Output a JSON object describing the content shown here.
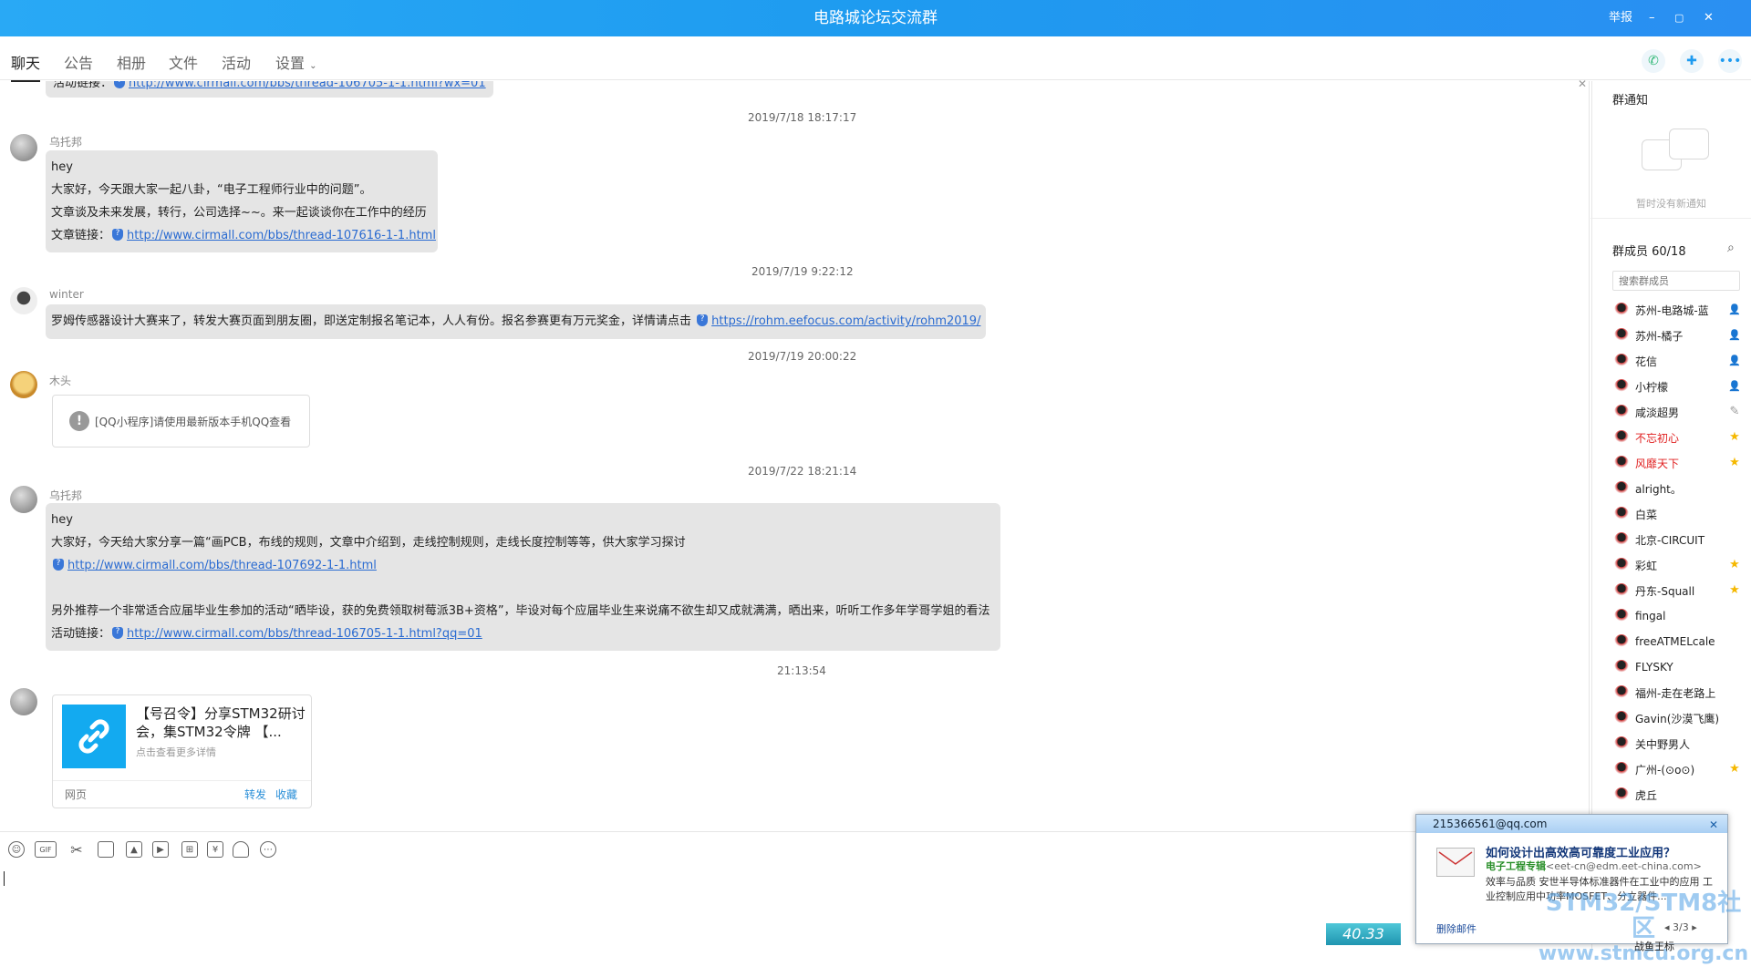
{
  "window": {
    "title": "电路城论坛交流群",
    "report": "举报",
    "minimize": "–",
    "restore": "▢",
    "close": "✕"
  },
  "tabs": [
    "聊天",
    "公告",
    "相册",
    "文件",
    "活动",
    "设置"
  ],
  "chat": {
    "top_partial_label": "活动链接：",
    "top_partial_link": "http://www.cirmall.com/bbs/thread-106705-1-1.html?wx=01",
    "messages": [
      {
        "time": "2019/7/18 18:17:17",
        "sender": "乌托邦",
        "lines": [
          "hey",
          "大家好，今天跟大家一起八卦，“电子工程师行业中的问题”。",
          "文章谈及未来发展，转行，公司选择~~。来一起谈谈你在工作中的经历"
        ],
        "link_label": "文章链接：",
        "link": "http://www.cirmall.com/bbs/thread-107616-1-1.html"
      },
      {
        "time": "2019/7/19 9:22:12",
        "sender": "winter",
        "text": "罗姆传感器设计大赛来了，转发大赛页面到朋友圈，即送定制报名笔记本，人人有份。报名参赛更有万元奖金，详情请点击",
        "link": "https://rohm.eefocus.com/activity/rohm2019/"
      },
      {
        "time": "2019/7/19 20:00:22",
        "sender": "木头",
        "mini_program": "[QQ小程序]请使用最新版本手机QQ查看"
      },
      {
        "time": "2019/7/22 18:21:14",
        "sender": "乌托邦",
        "lines": [
          "hey",
          "大家好，今天给大家分享一篇“画PCB，布线的规则，文章中介绍到，走线控制规则，走线长度控制等等，供大家学习探讨"
        ],
        "link1": "http://www.cirmall.com/bbs/thread-107692-1-1.html",
        "line2": "另外推荐一个非常适合应届毕业生参加的活动“晒毕设，获的免费领取树莓派3B+资格”，毕设对每个应届毕业生来说痛不欲生却又成就满满，晒出来，听听工作多年学哥学姐的看法",
        "link_label": "活动链接：",
        "link2": "http://www.cirmall.com/bbs/thread-106705-1-1.html?qq=01"
      },
      {
        "time": "21:13:54",
        "card": {
          "title": "【号召令】分享STM32研讨会，集STM32令牌 【...",
          "subtitle": "点击查看更多详情",
          "type": "网页",
          "forward": "转发",
          "favorite": "收藏"
        }
      }
    ]
  },
  "sidebar": {
    "notice_title": "群通知",
    "notice_empty": "暂时没有新通知",
    "members_title": "群成员 60/18",
    "search_placeholder": "搜索群成员",
    "members": [
      {
        "name": "苏州-电路城-蓝",
        "badge": "admin",
        "color": "#222"
      },
      {
        "name": "苏州-橘子",
        "badge": "admin",
        "color": "#222"
      },
      {
        "name": "花信",
        "badge": "admin",
        "color": "#222"
      },
      {
        "name": "小柠檬",
        "badge": "admin",
        "color": "#222"
      },
      {
        "name": "咸淡超男",
        "badge": "edit",
        "color": "#222"
      },
      {
        "name": "不忘初心",
        "badge": "star",
        "color": "#e02020"
      },
      {
        "name": "风靡天下",
        "badge": "star",
        "color": "#e02020"
      },
      {
        "name": "alright。",
        "badge": "",
        "color": "#222"
      },
      {
        "name": "白菜",
        "badge": "",
        "color": "#222"
      },
      {
        "name": "北京-CIRCUIT",
        "badge": "",
        "color": "#222"
      },
      {
        "name": "彩虹",
        "badge": "star",
        "color": "#222"
      },
      {
        "name": "丹东-Squall",
        "badge": "star",
        "color": "#222"
      },
      {
        "name": "fingal",
        "badge": "",
        "color": "#222"
      },
      {
        "name": "freeATMELcale",
        "badge": "",
        "color": "#222"
      },
      {
        "name": "FLYSKY",
        "badge": "",
        "color": "#222"
      },
      {
        "name": "福州-走在老路上",
        "badge": "",
        "color": "#222"
      },
      {
        "name": "Gavin(沙漠飞鹰)",
        "badge": "",
        "color": "#222"
      },
      {
        "name": "关中野男人",
        "badge": "",
        "color": "#222"
      },
      {
        "name": "广州-(⊙o⊙)",
        "badge": "star",
        "color": "#222"
      },
      {
        "name": "虎丘",
        "badge": "",
        "color": "#222"
      }
    ]
  },
  "popup": {
    "email": "215366561@qq.com",
    "title": "如何设计出高效高可靠度工业应用？",
    "from_name": "电子工程专辑",
    "from_addr": "<eet-cn@edm.eet-china.com>",
    "body": "效率与品质 安世半导体标准器件在工业中的应用 工业控制应用中功率MOSFET、分立器件...",
    "delete": "删除邮件",
    "pager": "3/3"
  },
  "gauge": "40.33",
  "watermark": [
    "STM32/STM8社区",
    "www.stmcu.org.cn"
  ],
  "bottom_partial": "战鱼王标"
}
